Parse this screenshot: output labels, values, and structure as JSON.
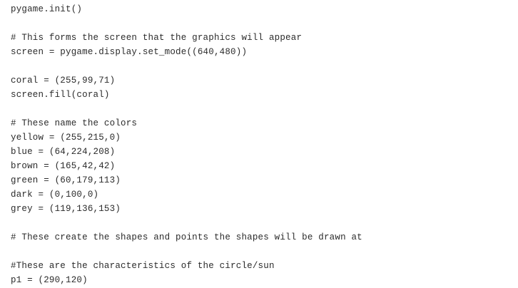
{
  "code": {
    "lines": [
      "pygame.init()",
      "",
      "# This forms the screen that the graphics will appear",
      "screen = pygame.display.set_mode((640,480))",
      "",
      "coral = (255,99,71)",
      "screen.fill(coral)",
      "",
      "# These name the colors",
      "yellow = (255,215,0)",
      "blue = (64,224,208)",
      "brown = (165,42,42)",
      "green = (60,179,113)",
      "dark = (0,100,0)",
      "grey = (119,136,153)",
      "",
      "# These create the shapes and points the shapes will be drawn at",
      "",
      "#These are the characteristics of the circle/sun",
      "p1 = (290,120)"
    ]
  }
}
